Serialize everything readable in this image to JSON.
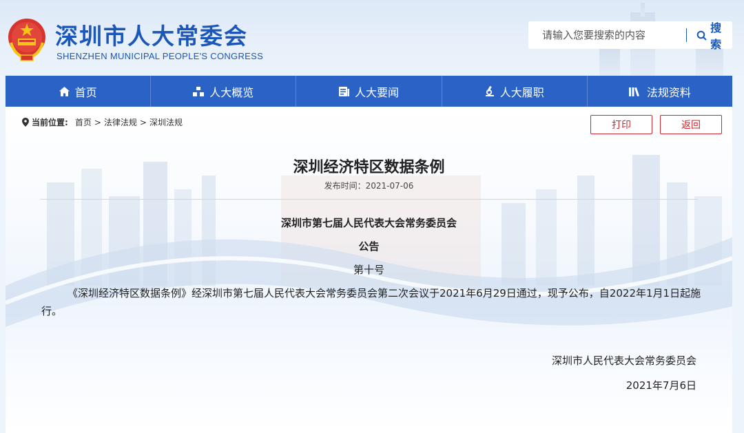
{
  "header": {
    "title": "深圳市人大常委会",
    "subtitle": "SHENZHEN MUNICIPAL PEOPLE'S CONGRESS",
    "search_placeholder": "请输入您要搜索的内容",
    "search_label": "搜索"
  },
  "nav": {
    "items": [
      {
        "label": "首页",
        "icon": "home-icon"
      },
      {
        "label": "人大概览",
        "icon": "org-icon"
      },
      {
        "label": "人大要闻",
        "icon": "news-icon"
      },
      {
        "label": "人大履职",
        "icon": "microscope-icon"
      },
      {
        "label": "法规资料",
        "icon": "books-icon"
      }
    ]
  },
  "breadcrumb": {
    "label": "当前位置:",
    "items": [
      "首页",
      "法律法规",
      "深圳法规"
    ],
    "separator": ">"
  },
  "actions": {
    "print": "打印",
    "back": "返回"
  },
  "article": {
    "title": "深圳经济特区数据条例",
    "publish_date": "发布时间：2021-07-06",
    "issuer": "深圳市第七届人民代表大会常务委员会",
    "notice_word": "公告",
    "notice_number": "第十号",
    "body": "《深圳经济特区数据条例》经深圳市第七届人民代表大会常务委员会第二次会议于2021年6月29日通过，现予公布，自2022年1月1日起施行。",
    "signature_org": "深圳市人民代表大会常务委员会",
    "signature_date": "2021年7月6日"
  },
  "colors": {
    "brand_blue": "#1a57b8",
    "nav_blue": "#2a62c6",
    "button_red": "#c9272d"
  }
}
